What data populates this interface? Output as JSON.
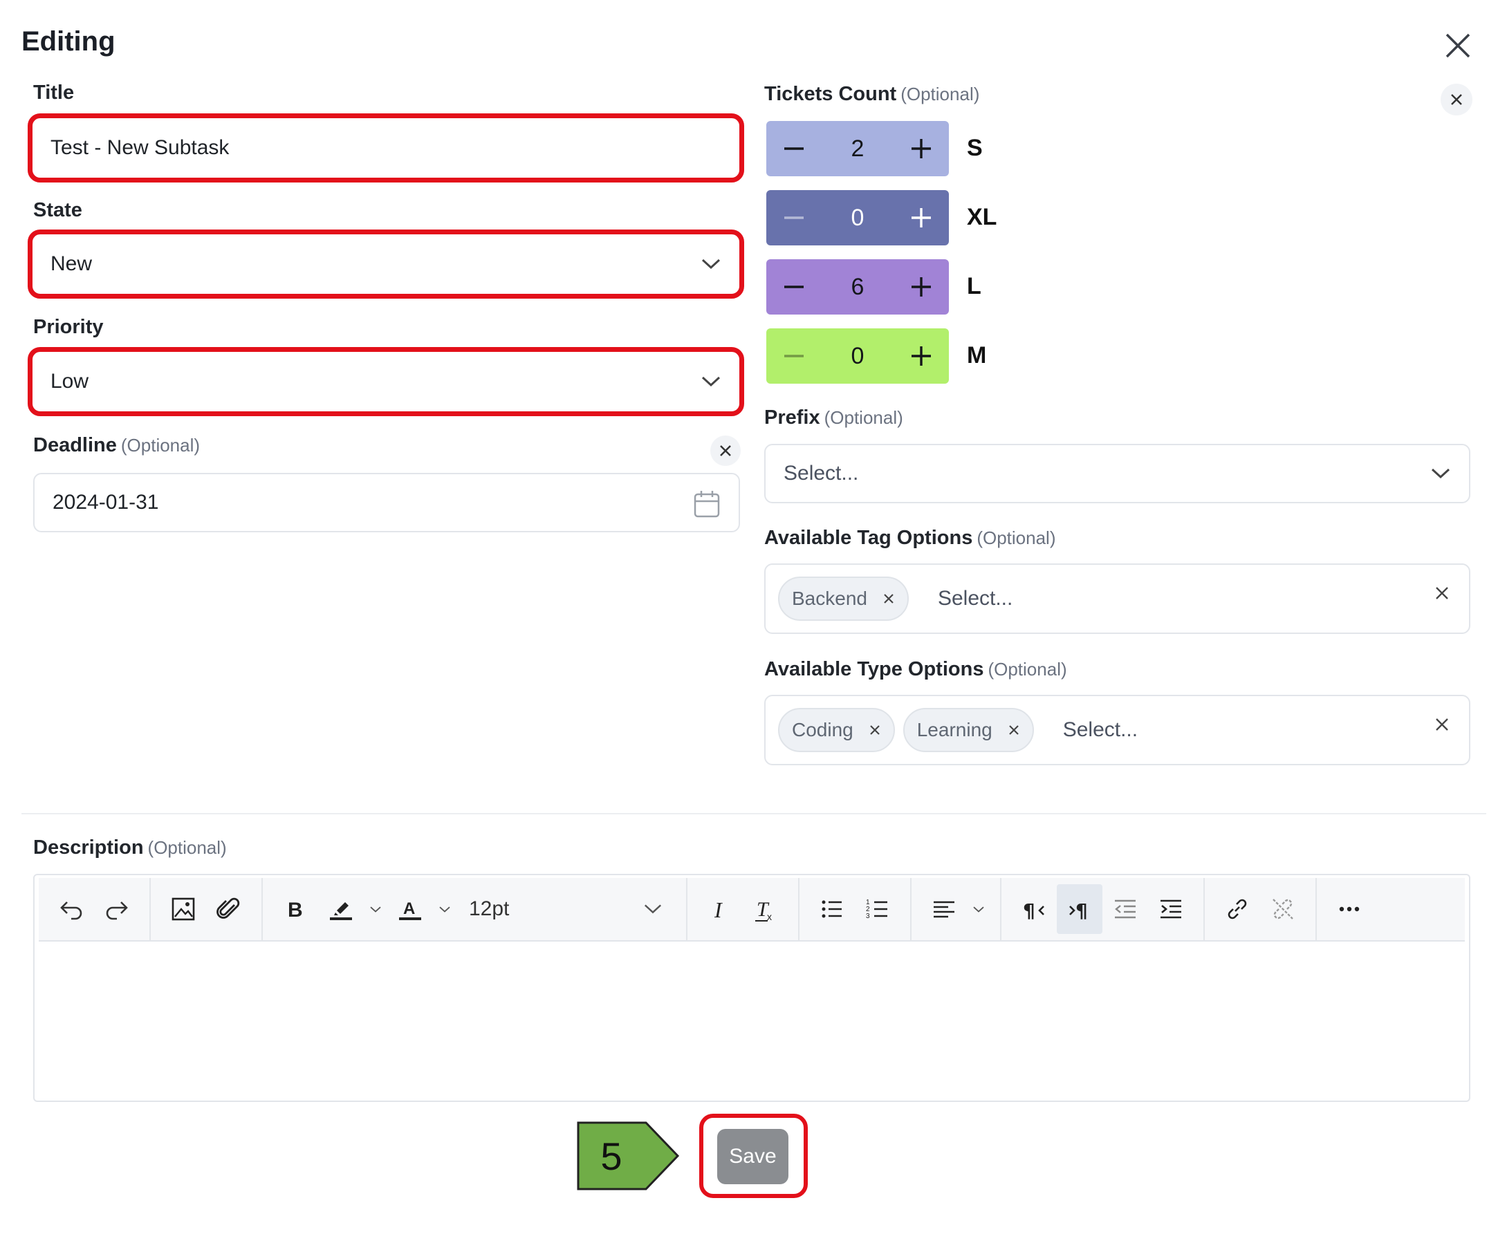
{
  "dialog": {
    "title": "Editing"
  },
  "fields": {
    "title": {
      "label": "Title",
      "value": "Test - New Subtask"
    },
    "state": {
      "label": "State",
      "value": "New"
    },
    "priority": {
      "label": "Priority",
      "value": "Low"
    },
    "deadline": {
      "label": "Deadline",
      "optional": "(Optional)",
      "value": "2024-01-31"
    }
  },
  "tickets": {
    "label": "Tickets Count",
    "optional": "(Optional)",
    "sizes": [
      {
        "size": "S",
        "count": "2",
        "color": "#a7b1e0"
      },
      {
        "size": "XL",
        "count": "0",
        "color": "#6872ac"
      },
      {
        "size": "L",
        "count": "6",
        "color": "#a183d6"
      },
      {
        "size": "M",
        "count": "0",
        "color": "#b2ef6b"
      }
    ]
  },
  "prefix": {
    "label": "Prefix",
    "optional": "(Optional)",
    "placeholder": "Select..."
  },
  "tag_options": {
    "label": "Available Tag Options",
    "optional": "(Optional)",
    "tags": [
      "Backend"
    ],
    "placeholder": "Select..."
  },
  "type_options": {
    "label": "Available Type Options",
    "optional": "(Optional)",
    "tags": [
      "Coding",
      "Learning"
    ],
    "placeholder": "Select..."
  },
  "description": {
    "label": "Description",
    "optional": "(Optional)",
    "font_size": "12pt"
  },
  "step_marker": "5",
  "save_label": "Save",
  "colors": {
    "highlight": "#e3101a",
    "marker": "#70ad47",
    "save": "#8a8d91"
  }
}
